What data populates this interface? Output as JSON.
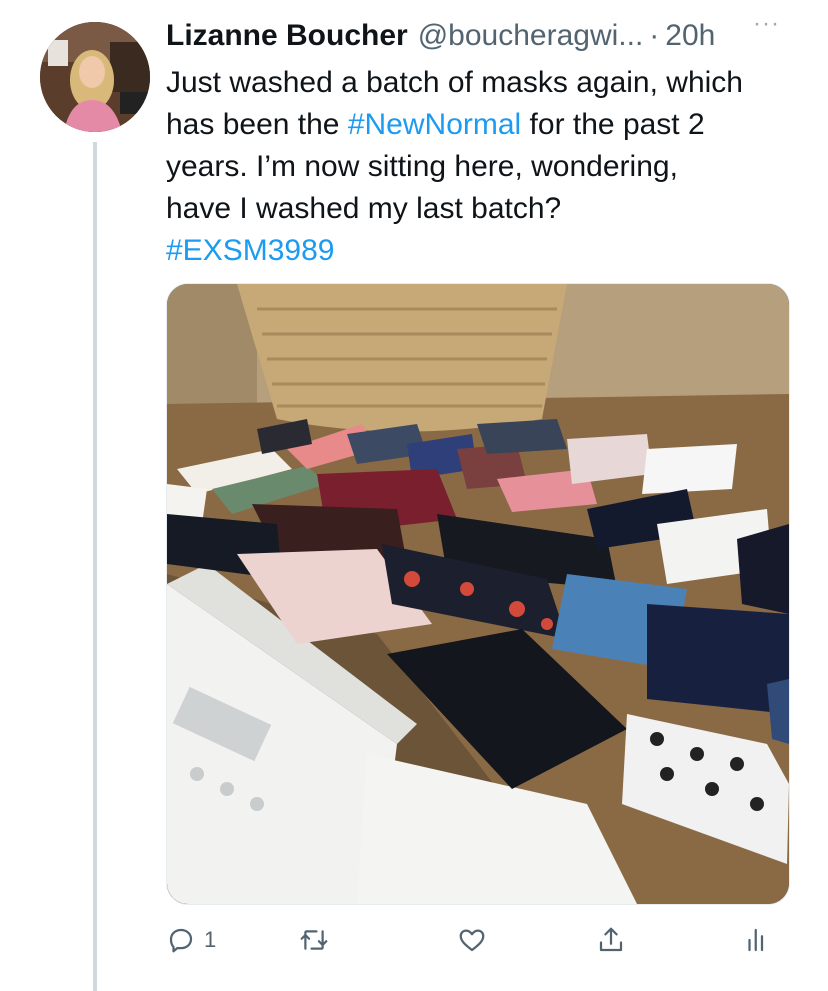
{
  "author": {
    "display_name": "Lizanne Boucher",
    "handle": "@boucheragwi...",
    "separator": "·",
    "timestamp": "20h",
    "avatar_icon": "profile-photo"
  },
  "more_label": "···",
  "tweet": {
    "lines": [
      "Just washed a batch of masks again, which",
      "has been the ",
      "#NewNormal",
      " for the past 2",
      "years. I’m now sitting here, wondering,",
      "have I washed my last batch?",
      "#EXSM3989"
    ]
  },
  "media": {
    "kind": "photo",
    "icon": "photo-masks-on-dryer"
  },
  "actions": {
    "reply_icon": "reply-icon",
    "reply_count": "1",
    "retweet_icon": "retweet-icon",
    "like_icon": "heart-icon",
    "share_icon": "share-icon",
    "analytics_icon": "analytics-icon"
  },
  "colors": {
    "link": "#1d9bf0",
    "text": "#0f1419",
    "secondary": "#536471",
    "thread_line": "#cfd9de"
  }
}
